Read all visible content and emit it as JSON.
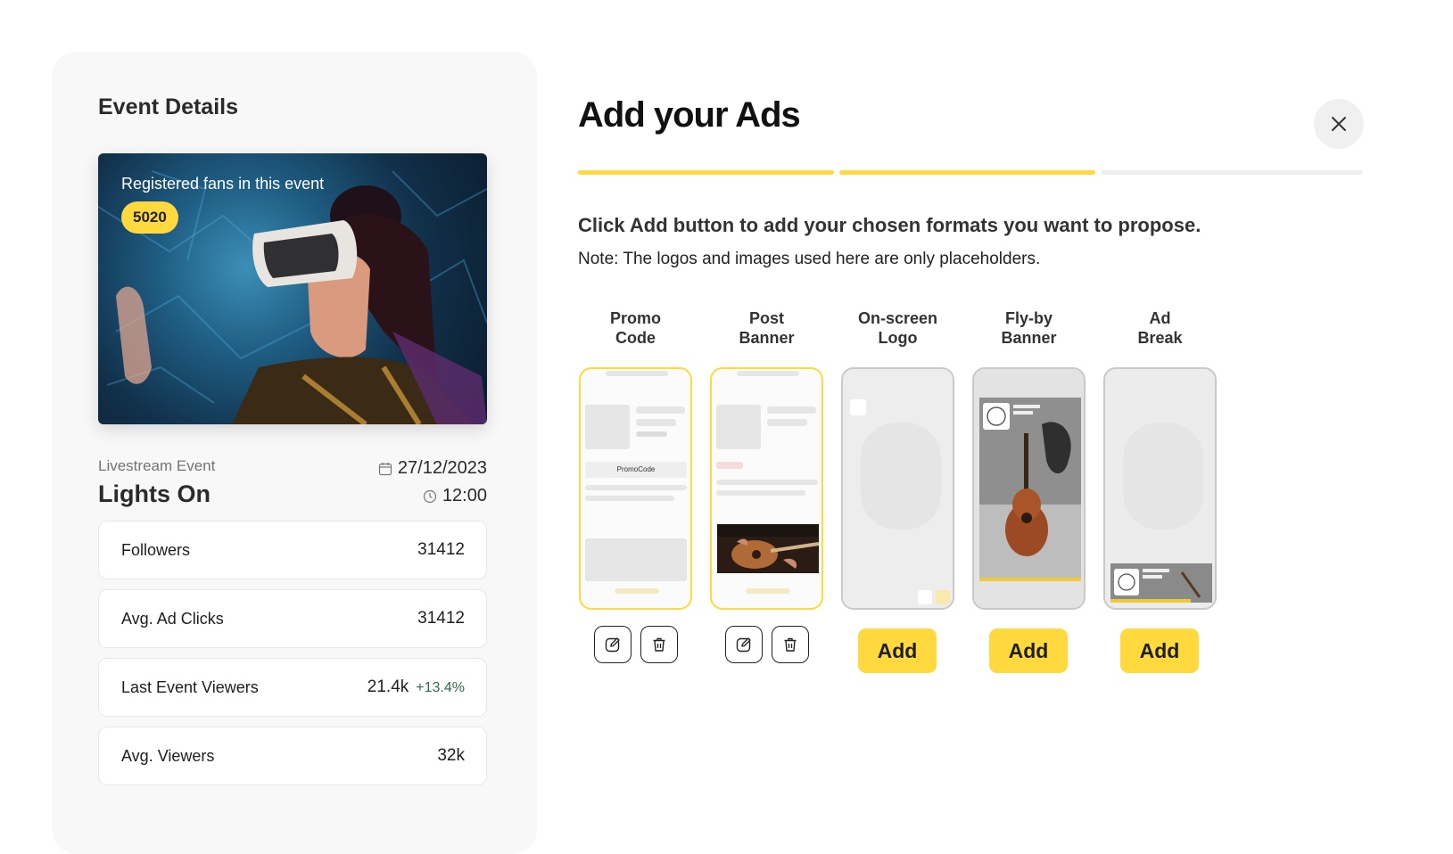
{
  "left_panel": {
    "title": "Event Details",
    "hero": {
      "fans_label": "Registered fans in this event",
      "fans_count": "5020"
    },
    "event_type": "Livestream Event",
    "event_name": "Lights On",
    "date": "27/12/2023",
    "time": "12:00",
    "stats": [
      {
        "label": "Followers",
        "value": "31412"
      },
      {
        "label": "Avg. Ad Clicks",
        "value": "31412"
      },
      {
        "label": "Last Event Viewers",
        "value": "21.4k",
        "delta": "+13.4%"
      },
      {
        "label": "Avg. Viewers",
        "value": "32k"
      }
    ]
  },
  "main": {
    "title": "Add your Ads",
    "progress": {
      "total_steps": 3,
      "completed_steps": 2
    },
    "instructions": "Click Add button to add your chosen formats you want to propose.",
    "note": "Note: The logos and images used here are only placeholders.",
    "formats": [
      {
        "label_line1": "Promo",
        "label_line2": "Code",
        "state": "added",
        "preview_text": "PromoCode"
      },
      {
        "label_line1": "Post",
        "label_line2": "Banner",
        "state": "added"
      },
      {
        "label_line1": "On-screen",
        "label_line2": "Logo",
        "state": "available",
        "button": "Add"
      },
      {
        "label_line1": "Fly-by",
        "label_line2": "Banner",
        "state": "available",
        "button": "Add"
      },
      {
        "label_line1": "Ad",
        "label_line2": "Break",
        "state": "available",
        "button": "Add"
      }
    ]
  },
  "colors": {
    "accent": "#ffd93d",
    "progress_track": "#efefef",
    "delta_positive": "#2f6b48"
  },
  "icons": [
    "calendar-icon",
    "clock-icon",
    "close-icon",
    "edit-icon",
    "trash-icon"
  ]
}
